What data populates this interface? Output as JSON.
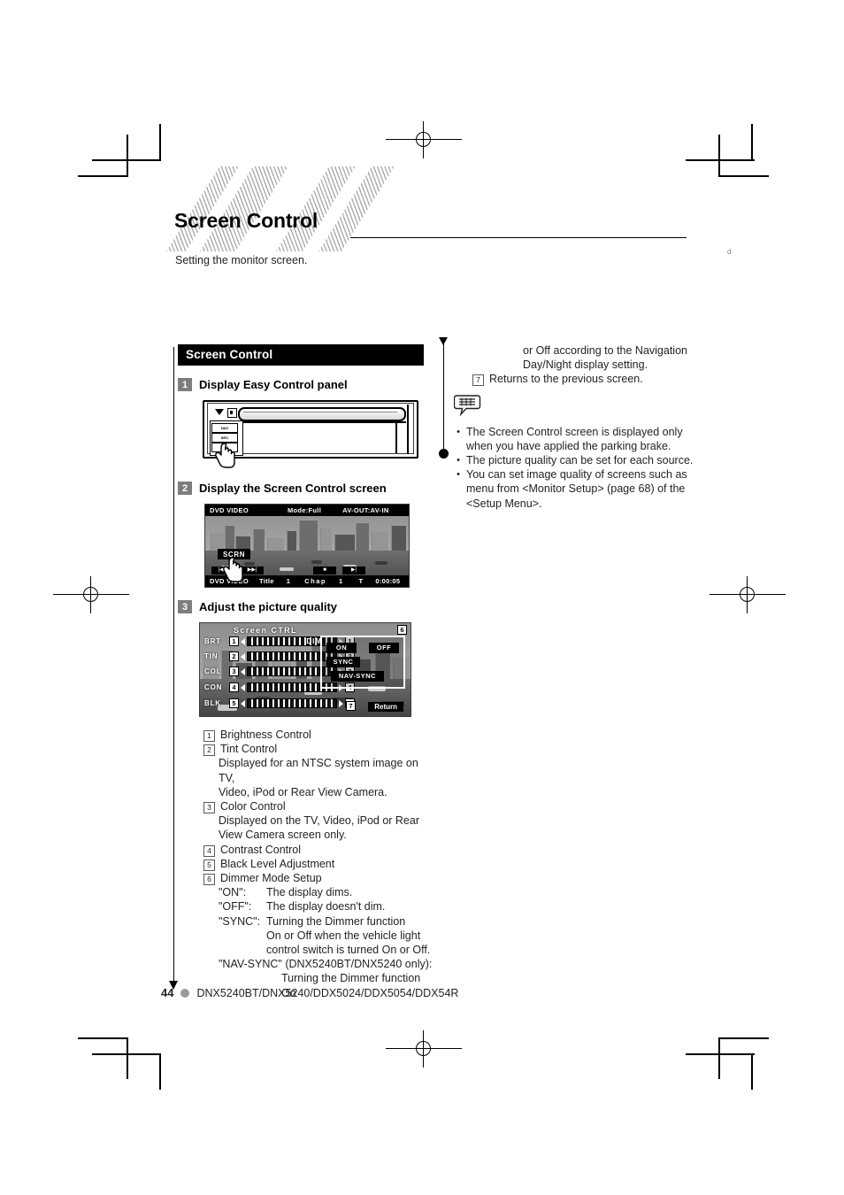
{
  "page": {
    "title": "Screen Control",
    "subtitle": "Setting the monitor screen.",
    "side_mark": "d",
    "number": "44",
    "models": "DNX5240BT/DNX5240/DDX5024/DDX5054/DDX54R"
  },
  "section": {
    "header": "Screen Control",
    "steps": [
      {
        "num": "1",
        "title": "Display Easy Control panel"
      },
      {
        "num": "2",
        "title": "Display the Screen Control screen"
      },
      {
        "num": "3",
        "title": "Adjust the picture quality"
      }
    ]
  },
  "head_unit": {
    "buttons": [
      "NAV",
      "SRC",
      "SRC"
    ]
  },
  "dvd_screen": {
    "top": {
      "source": "DVD VIDEO",
      "mode": "Mode:Full",
      "av": "AV-OUT:AV-IN"
    },
    "scrn_key": "SCRN",
    "transport": [
      "|◀◀",
      "▶▶|",
      "■",
      "▶|"
    ],
    "bottom": {
      "source": "DVD VIDEO",
      "title_label": "Title",
      "title_value": "1",
      "chap_label": "Chap",
      "chap_value": "1",
      "time_label": "T",
      "time_value": "0:00:05"
    }
  },
  "control_screen": {
    "title": "Screen CTRL",
    "sliders": [
      {
        "num": "1",
        "label": "BRT"
      },
      {
        "num": "2",
        "label": "TIN"
      },
      {
        "num": "3",
        "label": "COL"
      },
      {
        "num": "4",
        "label": "CON"
      },
      {
        "num": "5",
        "label": "BLK"
      }
    ],
    "dim": {
      "label": "DIM",
      "badge": "6",
      "buttons": [
        "ON",
        "OFF",
        "SYNC",
        "NAV-SYNC"
      ]
    },
    "return": {
      "badge": "7",
      "label": "Return"
    }
  },
  "descriptions": [
    {
      "num": "1",
      "text": "Brightness Control",
      "sub": []
    },
    {
      "num": "2",
      "text": "Tint Control",
      "sub": [
        "Displayed for an NTSC system image on TV,",
        "Video, iPod or Rear View Camera."
      ]
    },
    {
      "num": "3",
      "text": "Color Control",
      "sub": [
        "Displayed on the TV, Video, iPod or Rear",
        "View Camera screen only."
      ]
    },
    {
      "num": "4",
      "text": "Contrast Control",
      "sub": []
    },
    {
      "num": "5",
      "text": "Black Level Adjustment",
      "sub": []
    },
    {
      "num": "6",
      "text": "Dimmer Mode Setup",
      "sub": []
    }
  ],
  "dimmer_defs": [
    {
      "key": "\"ON\":",
      "value": "The display dims.",
      "cont": []
    },
    {
      "key": "\"OFF\":",
      "value": "The display doesn't dim.",
      "cont": []
    },
    {
      "key": "\"SYNC\":",
      "value": "Turning the Dimmer function",
      "cont": [
        "On or Off when the vehicle light",
        "control switch is turned On or Off."
      ]
    }
  ],
  "navsync": {
    "header": "\"NAV-SYNC\" (DNX5240BT/DNX5240 only):",
    "lines": [
      "Turning the Dimmer function On"
    ]
  },
  "right_column": {
    "continued": [
      "or Off according to the Navigation",
      "Day/Night display setting."
    ],
    "item7": {
      "num": "7",
      "text": "Returns to the previous screen."
    },
    "notes": [
      "The Screen Control screen is displayed only when you have applied the parking brake.",
      "The picture quality can be set for each source.",
      "You can set image quality of screens such as menu from <Monitor Setup> (page 68) of the <Setup Menu>."
    ]
  },
  "colors": {
    "header_bg": "#000000",
    "step_badge_bg": "#7d7d7d",
    "text": "#231f20",
    "footer_dot": "#9b9b9b"
  }
}
